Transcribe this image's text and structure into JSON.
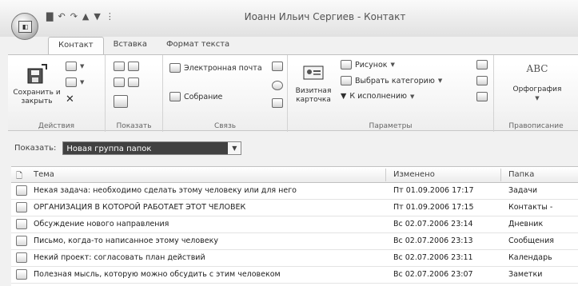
{
  "titlebar": {
    "title": "Иоанн Ильич Сергиев - Контакт",
    "qat_icons": [
      "save-icon",
      "undo-icon",
      "redo-icon",
      "up-arrow-icon",
      "down-arrow-icon",
      "customize-icon"
    ]
  },
  "tabs": [
    {
      "label": "Контакт",
      "active": true
    },
    {
      "label": "Вставка",
      "active": false
    },
    {
      "label": "Формат текста",
      "active": false
    }
  ],
  "ribbon": {
    "actions": {
      "save_close": "Сохранить и закрыть",
      "group": "Действия"
    },
    "show": {
      "group": "Показать"
    },
    "connect": {
      "email": "Электронная почта",
      "meeting": "Собрание",
      "group": "Связь"
    },
    "options": {
      "business_card": "Визитная карточка",
      "picture": "Рисунок",
      "categorize": "Выбрать категорию",
      "followup": "К исполнению",
      "group": "Параметры"
    },
    "proofing": {
      "spelling": "Орфография",
      "abc": "ABC",
      "group": "Правописание"
    }
  },
  "filter": {
    "label": "Показать:",
    "value": "Новая группа папок"
  },
  "list": {
    "headers": {
      "subject": "Тема",
      "modified": "Изменено",
      "folder": "Папка"
    },
    "rows": [
      {
        "icon": "task-icon",
        "subject": "Некая задача: необходимо сделать этому человеку или для него",
        "modified": "Пт 01.09.2006 17:17",
        "folder": "Задачи"
      },
      {
        "icon": "contact-icon",
        "subject": "ОРГАНИЗАЦИЯ В КОТОРОЙ РАБОТАЕТ ЭТОТ ЧЕЛОВЕК",
        "modified": "Пт 01.09.2006 17:15",
        "folder": "Контакты -"
      },
      {
        "icon": "journal-icon",
        "subject": "Обсуждение нового направления",
        "modified": "Вс 02.07.2006 23:14",
        "folder": "Дневник"
      },
      {
        "icon": "mail-icon",
        "subject": "Письмо, когда-то написанное этому человеку",
        "modified": "Вс 02.07.2006 23:13",
        "folder": "Сообщения"
      },
      {
        "icon": "calendar-icon",
        "subject": "Некий проект: согласовать план действий",
        "modified": "Вс 02.07.2006 23:11",
        "folder": "Календарь"
      },
      {
        "icon": "note-icon",
        "subject": "Полезная мысль, которую можно обсудить с этим человеком",
        "modified": "Вс 02.07.2006 23:07",
        "folder": "Заметки"
      }
    ]
  }
}
